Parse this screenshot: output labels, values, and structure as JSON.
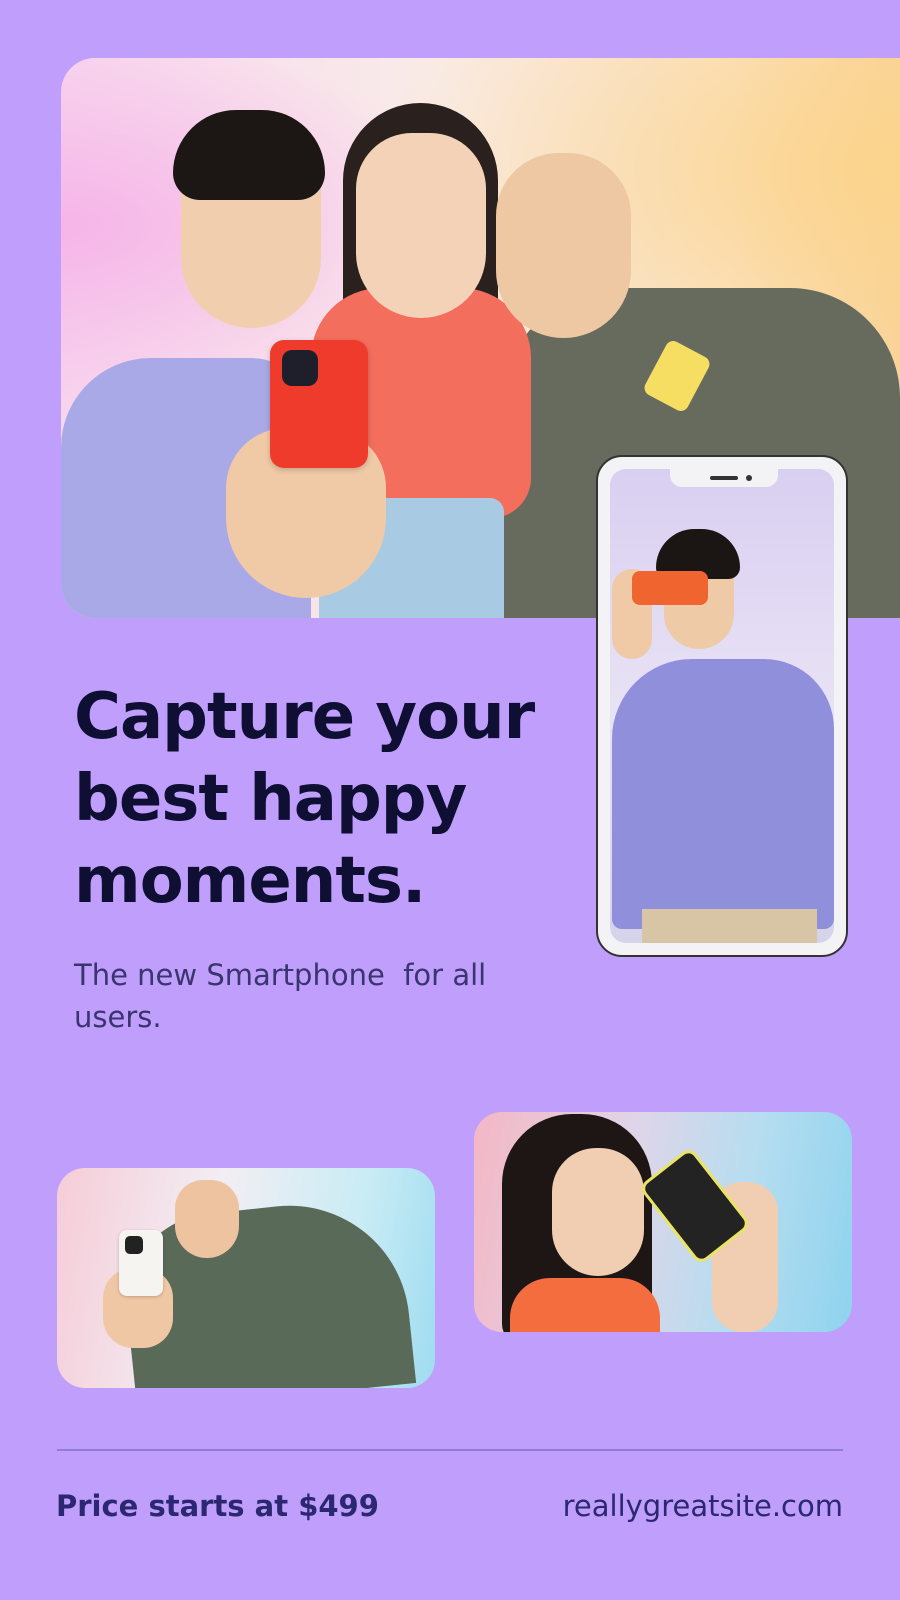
{
  "headline": {
    "line1": "Capture your",
    "line2": "best happy",
    "line3": "moments."
  },
  "subtext": {
    "line1": "The new Smartphone  for all",
    "line2": "users."
  },
  "footer": {
    "price": "Price starts at $499",
    "website": "reallygreatsite.com"
  },
  "colors": {
    "background": "#bf9ffb",
    "headline": "#0f0e33",
    "body_text": "#3a3570",
    "footer_text": "#2b2770"
  },
  "images": [
    "group-selfie-photo",
    "phone-mockup-with-man-photo",
    "man-with-phone-photo",
    "woman-with-phone-photo"
  ]
}
